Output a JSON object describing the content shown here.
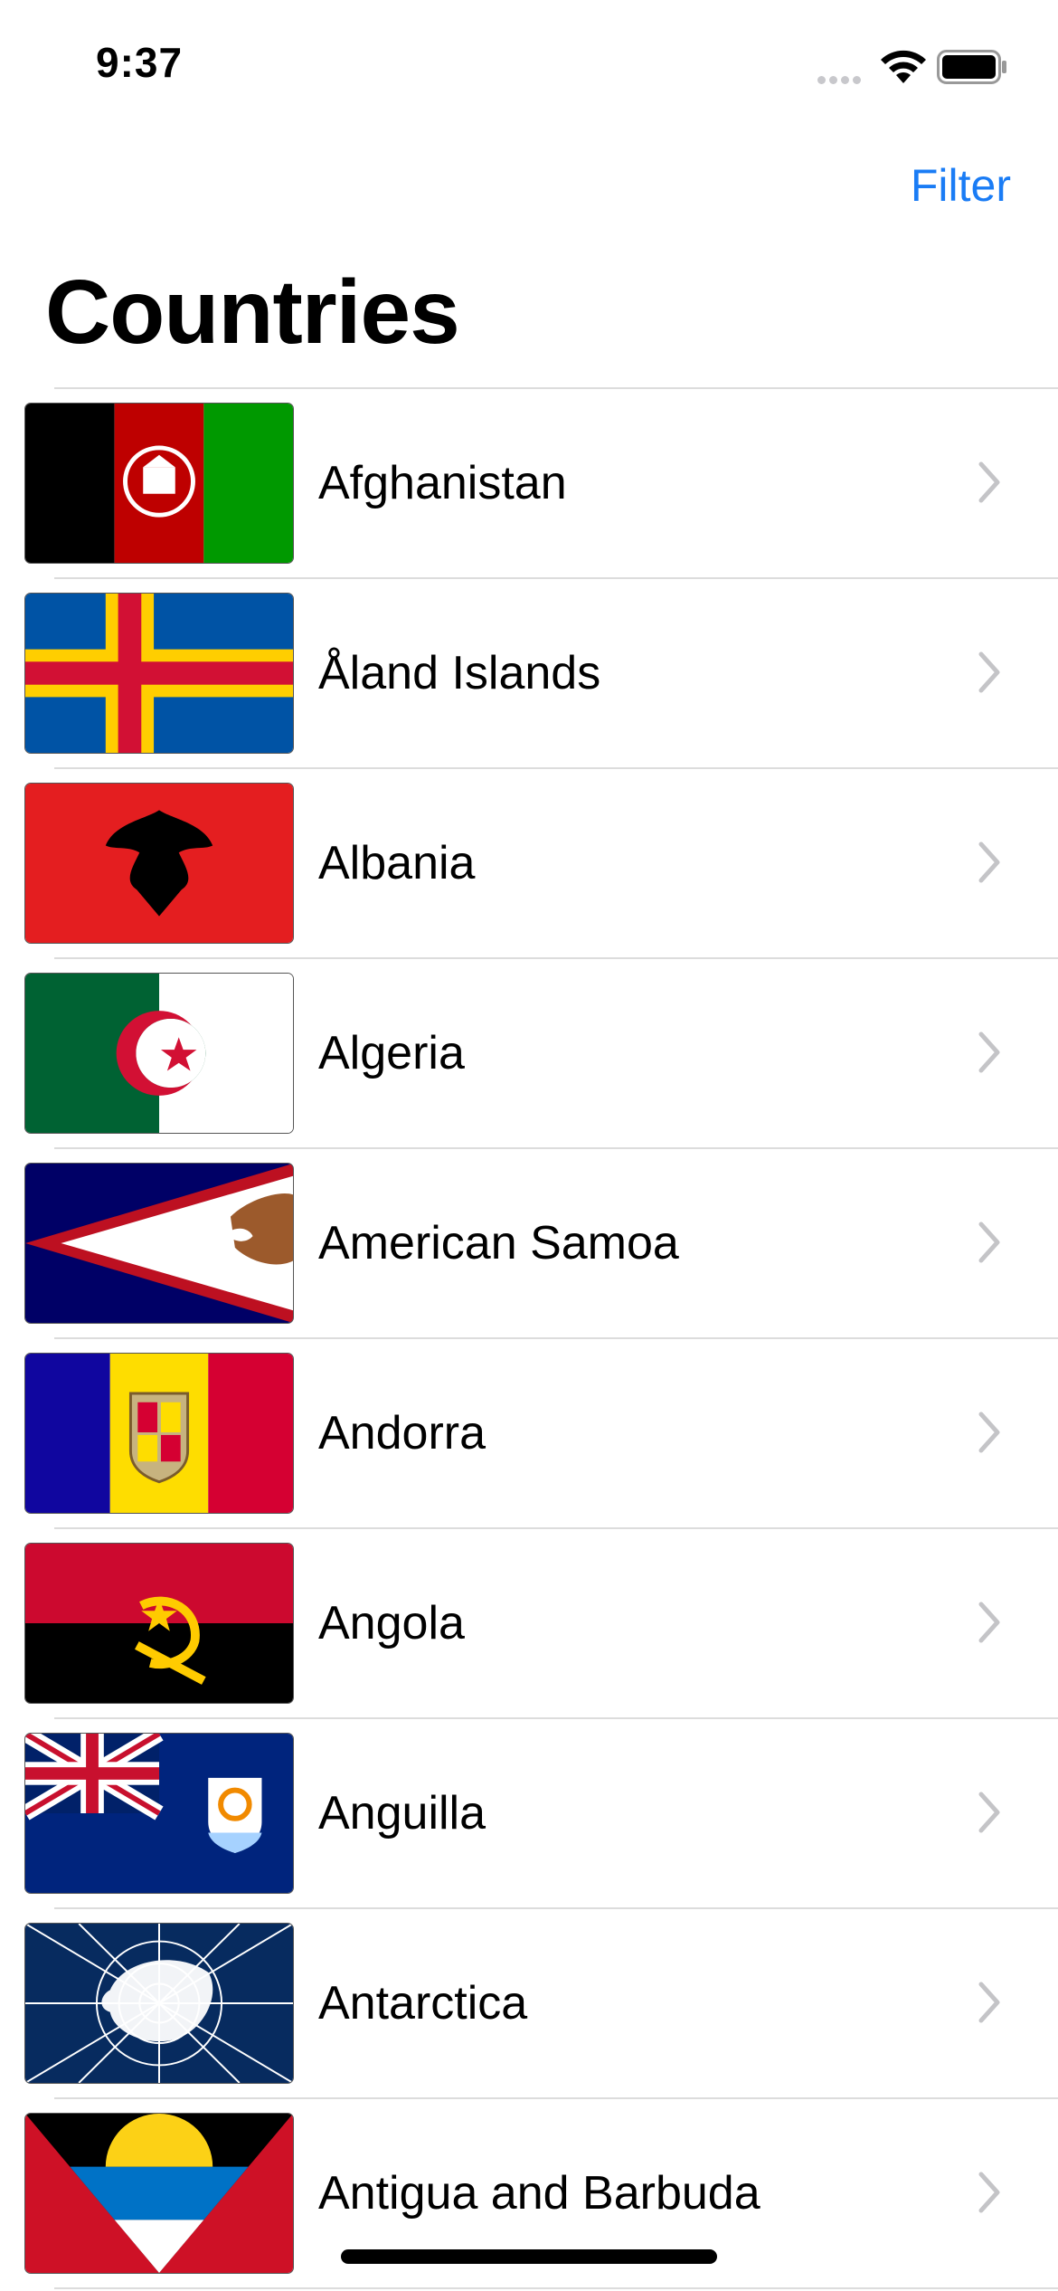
{
  "status_bar": {
    "time": "9:37"
  },
  "nav": {
    "filter_label": "Filter",
    "title": "Countries"
  },
  "countries": [
    {
      "name": "Afghanistan",
      "flag_icon": "afghanistan-flag-icon"
    },
    {
      "name": "Åland Islands",
      "flag_icon": "aland-islands-flag-icon"
    },
    {
      "name": "Albania",
      "flag_icon": "albania-flag-icon"
    },
    {
      "name": "Algeria",
      "flag_icon": "algeria-flag-icon"
    },
    {
      "name": "American Samoa",
      "flag_icon": "american-samoa-flag-icon"
    },
    {
      "name": "Andorra",
      "flag_icon": "andorra-flag-icon"
    },
    {
      "name": "Angola",
      "flag_icon": "angola-flag-icon"
    },
    {
      "name": "Anguilla",
      "flag_icon": "anguilla-flag-icon"
    },
    {
      "name": "Antarctica",
      "flag_icon": "antarctica-flag-icon"
    },
    {
      "name": "Antigua and Barbuda",
      "flag_icon": "antigua-and-barbuda-flag-icon"
    }
  ],
  "colors": {
    "accent": "#1a7cf5",
    "separator": "#dcdcdc",
    "chevron": "#c4c4c7"
  }
}
